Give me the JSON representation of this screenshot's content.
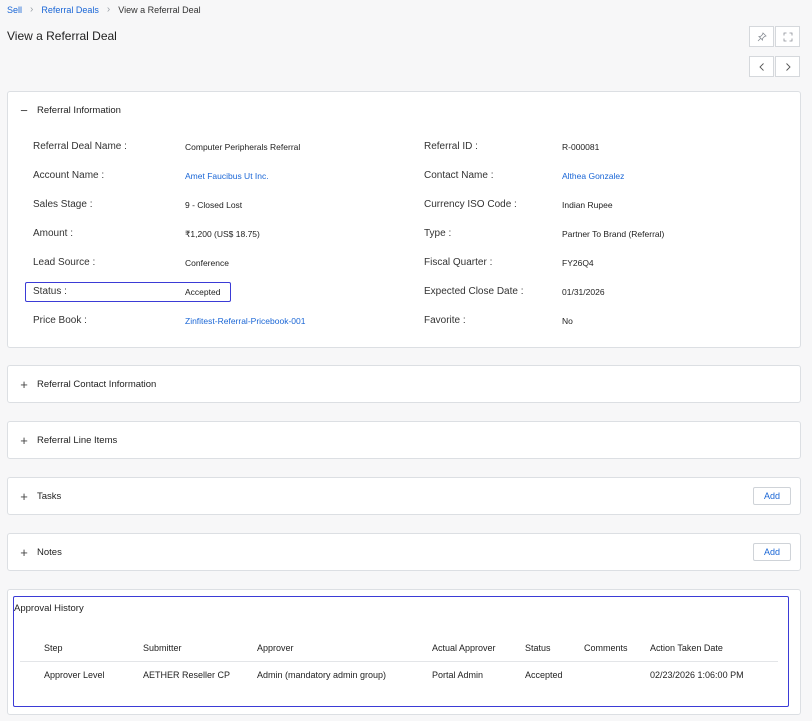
{
  "breadcrumb": {
    "items": [
      "Sell",
      "Referral Deals"
    ],
    "current": "View a Referral Deal"
  },
  "page": {
    "title": "View a Referral Deal"
  },
  "icons": {
    "pin": "pin-icon",
    "expand": "expand-icon",
    "prev": "chevron-left-icon",
    "next": "chevron-right-icon",
    "collapse": "minus-icon",
    "expand_section": "plus-icon"
  },
  "referral_information": {
    "title": "Referral Information",
    "left": [
      {
        "label": "Referral Deal Name :",
        "value": "Computer Peripherals Referral"
      },
      {
        "label": "Account Name :",
        "value": "Amet Faucibus Ut Inc."
      },
      {
        "label": "Sales Stage :",
        "value": "9 - Closed Lost"
      },
      {
        "label": "Amount :",
        "value": "₹1,200 (US$ 18.75)"
      },
      {
        "label": "Lead Source :",
        "value": "Conference"
      },
      {
        "label": "Status :",
        "value": "Accepted"
      },
      {
        "label": "Price Book :",
        "value": "Zinfitest-Referral-Pricebook-001"
      }
    ],
    "right": [
      {
        "label": "Referral ID :",
        "value": "R-000081"
      },
      {
        "label": "Contact Name :",
        "value": "Althea Gonzalez"
      },
      {
        "label": "Currency ISO Code :",
        "value": "Indian Rupee"
      },
      {
        "label": "Type :",
        "value": "Partner To Brand (Referral)"
      },
      {
        "label": "Fiscal Quarter :",
        "value": "FY26Q4"
      },
      {
        "label": "Expected Close Date :",
        "value": "01/31/2026"
      },
      {
        "label": "Favorite :",
        "value": "No"
      }
    ]
  },
  "sections": {
    "contact": {
      "title": "Referral Contact Information"
    },
    "line_items": {
      "title": "Referral Line Items"
    },
    "tasks": {
      "title": "Tasks",
      "add_label": "Add"
    },
    "notes": {
      "title": "Notes",
      "add_label": "Add"
    }
  },
  "approval_history": {
    "title": "Approval History",
    "columns": [
      "Step",
      "Submitter",
      "Approver",
      "Actual Approver",
      "Status",
      "Comments",
      "Action Taken Date"
    ],
    "rows": [
      [
        "Approver Level",
        "AETHER Reseller CP",
        "Admin (mandatory admin group)",
        "Portal Admin",
        "Accepted",
        "",
        "02/23/2026 1:06:00 PM"
      ]
    ]
  },
  "colors": {
    "link": "#1a66d6",
    "highlight_border": "#3b3bd6",
    "background": "#f7f7f8"
  }
}
